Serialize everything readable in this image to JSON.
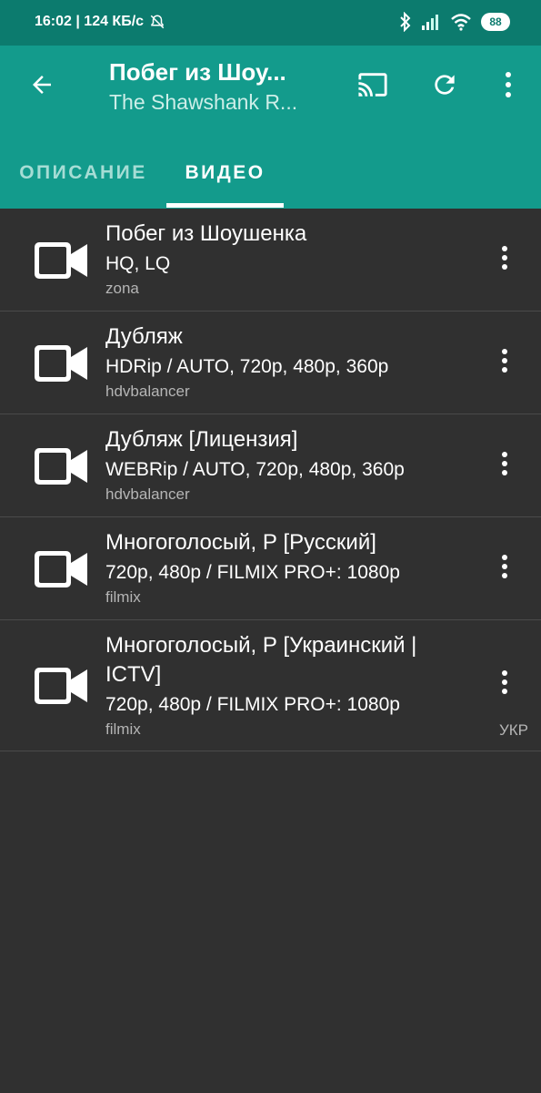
{
  "status": {
    "time_speed": "16:02 | 124 КБ/с",
    "battery": "88"
  },
  "toolbar": {
    "title": "Побег из Шоу...",
    "subtitle": "The Shawshank R..."
  },
  "tabs": [
    {
      "label": "ОПИСАНИЕ"
    },
    {
      "label": "ВИДЕО"
    }
  ],
  "colors": {
    "toolbar": "#139b8c",
    "statusbar": "#0c7b6e",
    "background": "#303030"
  },
  "items": [
    {
      "title": "Побег из Шоушенка",
      "quality": "HQ, LQ",
      "source": "zona",
      "tag": ""
    },
    {
      "title": "Дубляж",
      "quality": "HDRip / AUTO, 720p, 480p, 360p",
      "source": "hdvbalancer",
      "tag": ""
    },
    {
      "title": "Дубляж [Лицензия]",
      "quality": "WEBRip / AUTO, 720p, 480p, 360p",
      "source": "hdvbalancer",
      "tag": ""
    },
    {
      "title": "Многоголосый, Р [Русский]",
      "quality": "720p, 480p / FILMIX PRO+: 1080p",
      "source": "filmix",
      "tag": ""
    },
    {
      "title": "Многоголосый, Р [Украинский | ICTV]",
      "quality": "720p, 480p / FILMIX PRO+: 1080p",
      "source": "filmix",
      "tag": "УКР"
    }
  ]
}
